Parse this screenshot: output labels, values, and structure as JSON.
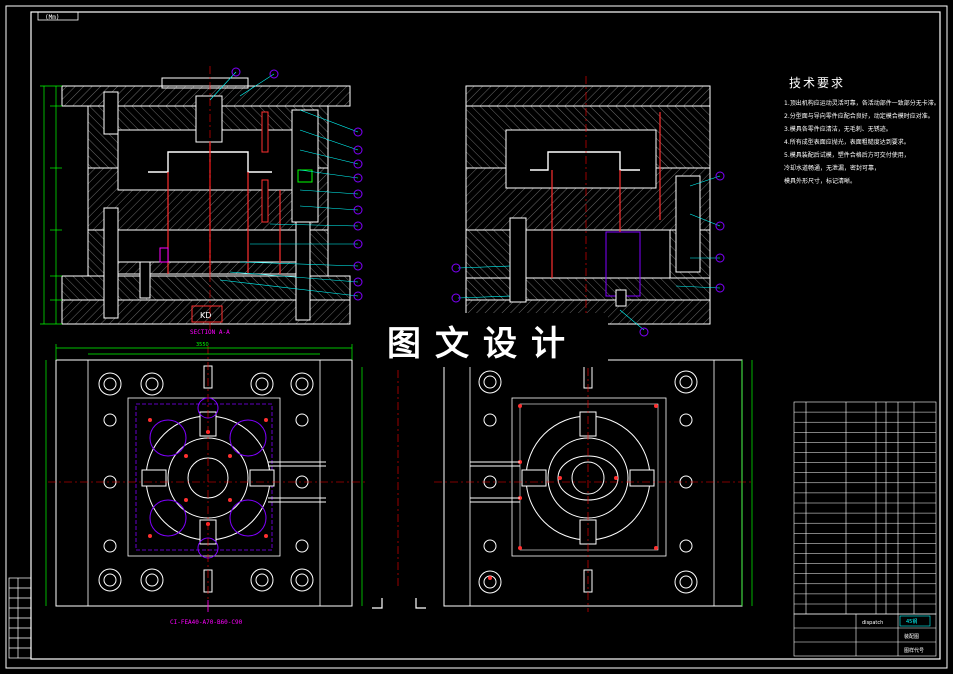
{
  "corner_tag": "(Mm)",
  "watermark": "图文设计",
  "section_label": "SECTION A-A",
  "kd_label": "KD",
  "dim_top_width": "3550",
  "part_designation": "CI-FEA40-A70-B60-C90",
  "tech": {
    "title": "技术要求",
    "notes": [
      "1.顶出机构应运动灵活可靠，各活动部件一致部分无卡滞。",
      "2.分型面与导向零件应配合良好，动定模合模时应对准。",
      "3.模具各零件应清洁，无毛刺、无锈迹。",
      "4.所有成型表面应抛光，表面粗糙度达到要求。",
      "5.模具装配后试模，塑件合格后方可交付使用，",
      "冷却水道畅通，无泄漏，密封可靠，",
      "模具外形尺寸，标记清晰。"
    ]
  },
  "title_block": {
    "name_cell": "dispatch",
    "material_cell": "45钢",
    "assembly_cell": "装配图",
    "drawing_no_cell": "图样代号"
  },
  "colors": {
    "background": "#000000",
    "outline": "#ffffff",
    "dimension": "#00ff00",
    "balloon": "#8000ff",
    "centerline": "#ff0000",
    "leader": "#00ffff",
    "magenta": "#ff00ff",
    "hatch": "#a0a0a0"
  }
}
